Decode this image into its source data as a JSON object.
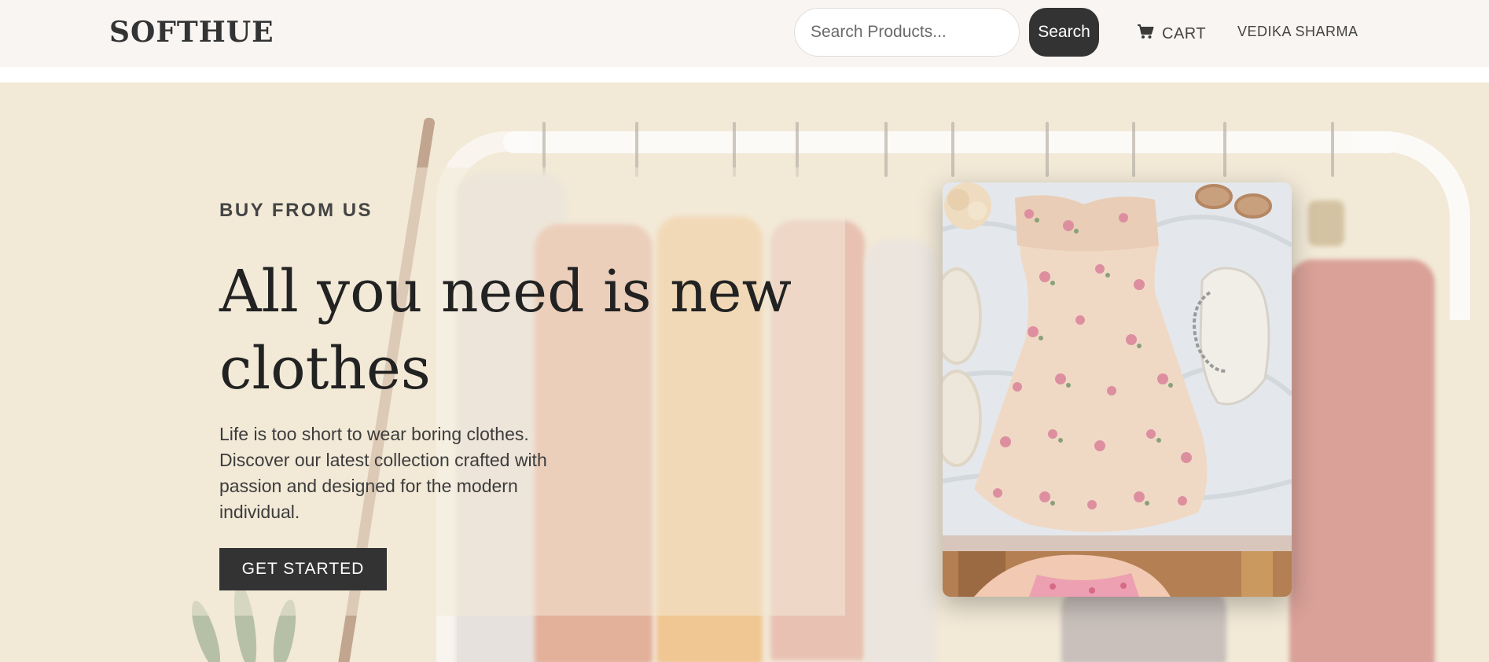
{
  "header": {
    "logo": "SOFTHUE",
    "search": {
      "placeholder": "Search Products...",
      "button_label": "Search"
    },
    "cart_label": "CART",
    "user_name": "VEDIKA SHARMA",
    "icons": {
      "cart": "cart-icon"
    }
  },
  "hero": {
    "eyebrow": "BUY FROM US",
    "headline": "All you need is new clothes",
    "description": "Life is too short to wear boring clothes. Discover our latest collection crafted with passion and designed for the modern individual.",
    "cta_label": "GET STARTED"
  },
  "colors": {
    "header_bg": "#f8f5f3",
    "hero_bg": "#f2e9d7",
    "dark_button": "#333333",
    "text_primary": "#222222"
  }
}
